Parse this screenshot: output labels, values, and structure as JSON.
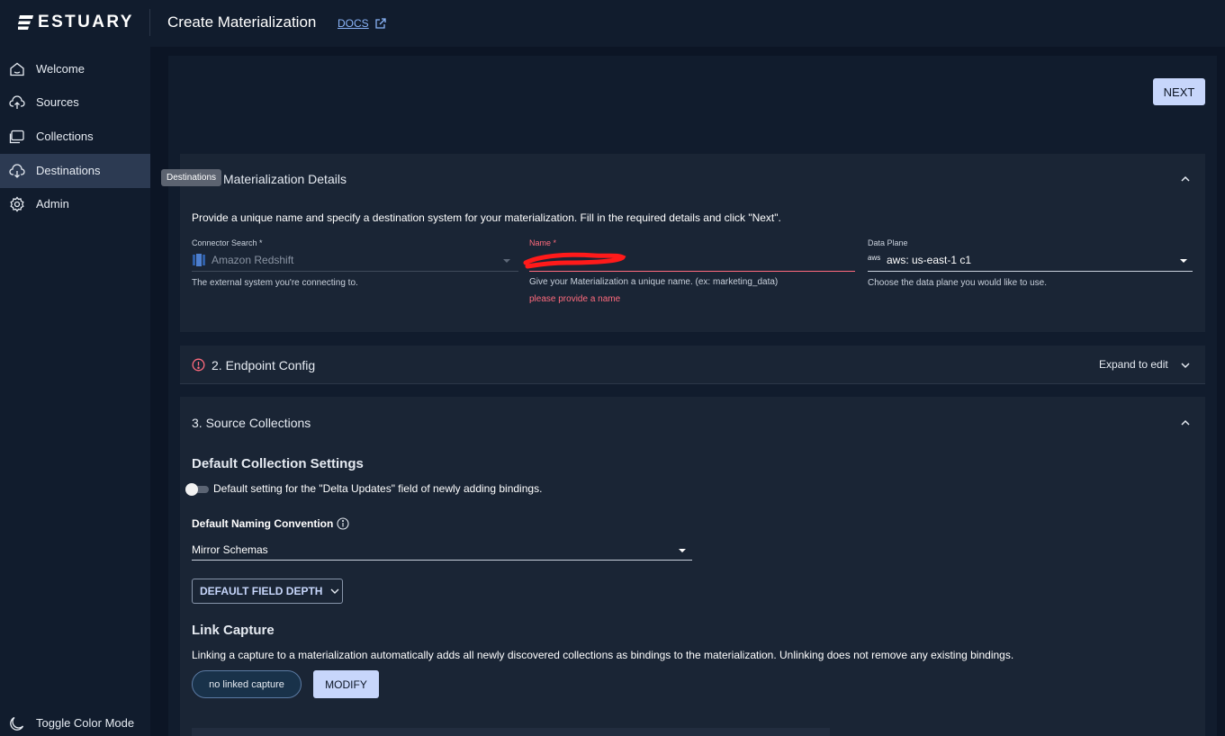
{
  "brand": {
    "name": "ESTUARY"
  },
  "header": {
    "title": "Create Materialization",
    "docs_label": "DOCS"
  },
  "sidebar": {
    "items": [
      {
        "label": "Welcome",
        "icon": "home-icon"
      },
      {
        "label": "Sources",
        "icon": "cloud-upload-icon"
      },
      {
        "label": "Collections",
        "icon": "collections-icon"
      },
      {
        "label": "Destinations",
        "icon": "cloud-download-icon",
        "active": true
      },
      {
        "label": "Admin",
        "icon": "gear-icon"
      }
    ],
    "tooltip": "Destinations",
    "toggle_label": "Toggle Color Mode"
  },
  "toolbar": {
    "next_label": "NEXT"
  },
  "details_card": {
    "title": "Materialization Details",
    "description": "Provide a unique name and specify a destination system for your materialization. Fill in the required details and click \"Next\".",
    "connector": {
      "label": "Connector Search",
      "value": "Amazon Redshift",
      "helper": "The external system you're connecting to."
    },
    "name": {
      "label": "Name",
      "value": "",
      "helper": "Give your Materialization a unique name. (ex: marketing_data)",
      "error": "please provide a name"
    },
    "data_plane": {
      "label": "Data Plane",
      "value": "aws: us-east-1 c1",
      "helper": "Choose the data plane you would like to use."
    }
  },
  "endpoint_card": {
    "title": "2. Endpoint Config",
    "expand_label": "Expand to edit"
  },
  "collections_card": {
    "title": "3. Source Collections",
    "defaults_heading": "Default Collection Settings",
    "delta_toggle_label": "Default setting for the \"Delta Updates\" field of newly adding bindings.",
    "naming_label": "Default Naming Convention",
    "naming_value": "Mirror Schemas",
    "field_depth_label": "DEFAULT FIELD DEPTH",
    "link_heading": "Link Capture",
    "link_description": "Linking a capture to a materialization automatically adds all newly discovered collections as bindings to the materialization. Unlinking does not remove any existing bindings.",
    "linked_chip": "no linked capture",
    "modify_label": "MODIFY"
  },
  "colors": {
    "accent": "#c7d6fb",
    "error": "#ff6b7d",
    "background": "#0c1525",
    "surface": "#111c2d",
    "card": "#1a2535"
  }
}
